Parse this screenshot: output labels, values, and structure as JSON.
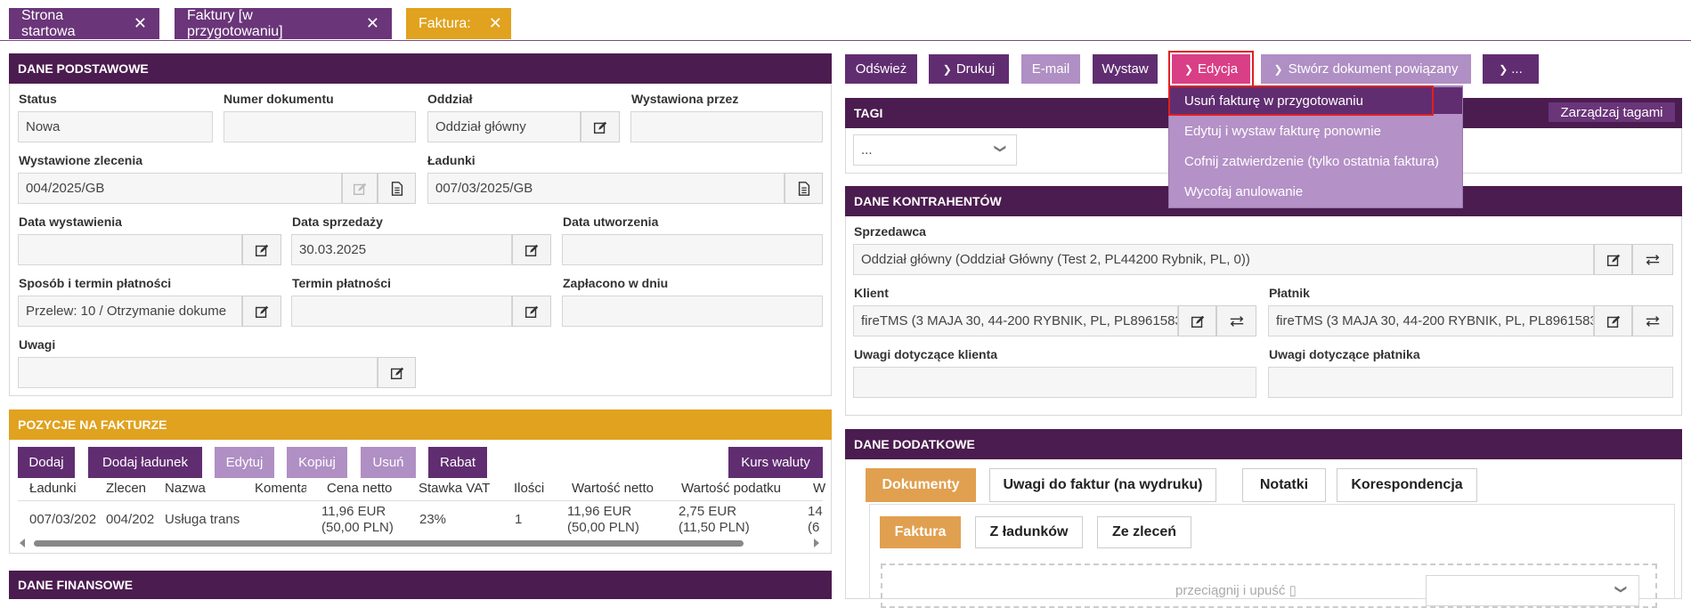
{
  "tabs": [
    {
      "label": "Strona startowa"
    },
    {
      "label": "Faktury [w przygotowaniu]"
    },
    {
      "label": "Faktura:"
    }
  ],
  "colors": {
    "dark": "#4b1c4f",
    "accent": "#612d71",
    "gold": "#e0a21f",
    "light": "#b08fc4",
    "highlight": "#e02020"
  },
  "basic": {
    "header": "DANE PODSTAWOWE",
    "status_label": "Status",
    "status_value": "Nowa",
    "number_label": "Numer dokumentu",
    "number_value": "",
    "branch_label": "Oddział",
    "branch_value": "Oddział główny",
    "issued_by_label": "Wystawiona przez",
    "issued_by_value": "",
    "orders_label": "Wystawione zlecenia",
    "orders_value": "004/2025/GB",
    "loads_label": "Ładunki",
    "loads_value": "007/03/2025/GB",
    "issue_date_label": "Data wystawienia",
    "issue_date_value": "",
    "sale_date_label": "Data sprzedaży",
    "sale_date_value": "30.03.2025",
    "created_label": "Data utworzenia",
    "created_value": "",
    "payment_method_label": "Sposób i termin płatności",
    "payment_method_value": "Przelew: 10 / Otrzymanie dokume",
    "payment_due_label": "Termin płatności",
    "payment_due_value": "",
    "paid_on_label": "Zapłacono w dniu",
    "paid_on_value": "",
    "notes_label": "Uwagi",
    "notes_value": ""
  },
  "items": {
    "header": "POZYCJE NA FAKTURZE",
    "buttons": {
      "add": "Dodaj",
      "add_load": "Dodaj ładunek",
      "edit": "Edytuj",
      "copy": "Kopiuj",
      "delete": "Usuń",
      "discount": "Rabat",
      "currency": "Kurs waluty"
    },
    "columns": [
      "Ładunki",
      "Zlecen",
      "Nazwa",
      "Komentar",
      "Cena netto",
      "Stawka VAT",
      "Ilości",
      "Wartość netto",
      "Wartość podatku",
      "W"
    ],
    "row": {
      "loads": "007/03/202",
      "orders": "004/202",
      "name": "Usługa trans",
      "comment": "",
      "price_1": "11,96 EUR",
      "price_2": "(50,00 PLN)",
      "vat": "23%",
      "qty": "1",
      "net_1": "11,96 EUR",
      "net_2": "(50,00 PLN)",
      "tax_1": "2,75 EUR",
      "tax_2": "(11,50 PLN)",
      "w_1": "14",
      "w_2": "(6"
    }
  },
  "finance": {
    "header": "DANE FINANSOWE"
  },
  "toolbar": {
    "refresh": "Odśwież",
    "print": "Drukuj",
    "email": "E-mail",
    "issue": "Wystaw",
    "edit": "Edycja",
    "related": "Stwórz dokument powiązany",
    "more": "..."
  },
  "edit_menu": {
    "items": [
      "Usuń fakturę w przygotowaniu",
      "Edytuj i wystaw fakturę ponownie",
      "Cofnij zatwierdzenie (tylko ostatnia faktura)",
      "Wycofaj anulowanie"
    ]
  },
  "tags": {
    "header": "TAGI",
    "manage": "Zarządzaj tagami",
    "select_value": "..."
  },
  "contractors": {
    "header": "DANE KONTRAHENTÓW",
    "seller_label": "Sprzedawca",
    "seller_value": "Oddział główny  (Oddział Główny  (Test 2, PL44200 Rybnik, PL, 0))",
    "client_label": "Klient",
    "client_value": "fireTMS (3 MAJA 30, 44-200 RYBNIK, PL, PL8961583",
    "payer_label": "Płatnik",
    "payer_value": "fireTMS (3 MAJA 30, 44-200 RYBNIK, PL, PL8961583",
    "client_notes_label": "Uwagi dotyczące klienta",
    "payer_notes_label": "Uwagi dotyczące płatnika"
  },
  "additional": {
    "header": "DANE DODATKOWE",
    "tabs": [
      "Dokumenty",
      "Uwagi do faktur (na wydruku)",
      "Notatki",
      "Korespondencja"
    ],
    "subtabs": [
      "Faktura",
      "Z ładunków",
      "Ze zleceń"
    ],
    "drop_text": "przeciągnij i upuść"
  }
}
